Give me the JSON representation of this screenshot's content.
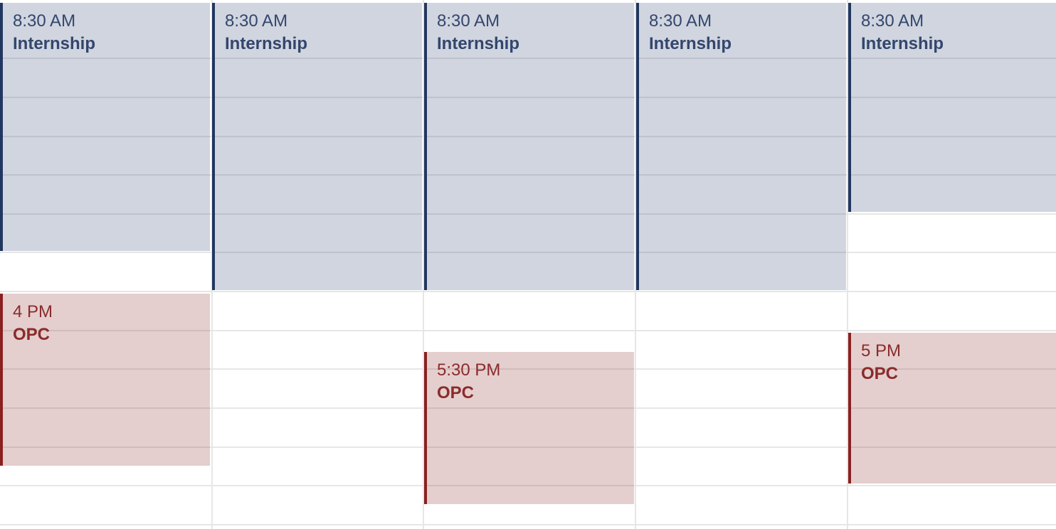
{
  "calendar": {
    "days": [
      {
        "events": [
          {
            "time": "8:30 AM",
            "title": "Internship",
            "kind": "internship"
          },
          {
            "time": "4 PM",
            "title": "OPC",
            "kind": "opc"
          }
        ]
      },
      {
        "events": [
          {
            "time": "8:30 AM",
            "title": "Internship",
            "kind": "internship"
          }
        ]
      },
      {
        "events": [
          {
            "time": "8:30 AM",
            "title": "Internship",
            "kind": "internship"
          },
          {
            "time": "5:30 PM",
            "title": "OPC",
            "kind": "opc"
          }
        ]
      },
      {
        "events": [
          {
            "time": "8:30 AM",
            "title": "Internship",
            "kind": "internship"
          }
        ]
      },
      {
        "events": [
          {
            "time": "8:30 AM",
            "title": "Internship",
            "kind": "internship"
          },
          {
            "time": "5 PM",
            "title": "OPC",
            "kind": "opc"
          }
        ]
      }
    ]
  },
  "colors": {
    "internship_fill": "#cfd4dd",
    "internship_border": "#22375f",
    "opc_fill": "#e4cfcf",
    "opc_border": "#8a2020",
    "grid_line": "#e6e6e6"
  }
}
